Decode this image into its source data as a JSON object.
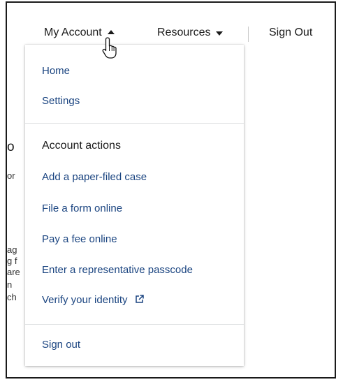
{
  "nav": {
    "my_account_label": "My Account",
    "resources_label": "Resources",
    "sign_out_label": "Sign Out"
  },
  "background_fragments": [
    "o",
    "or",
    "ag",
    "g f",
    "are",
    "n",
    "ch"
  ],
  "dropdown": {
    "top_items": [
      {
        "label": "Home"
      },
      {
        "label": "Settings"
      }
    ],
    "section_heading": "Account actions",
    "action_items": [
      {
        "label": "Add a paper-filed case"
      },
      {
        "label": "File a form online"
      },
      {
        "label": "Pay a fee online"
      },
      {
        "label": "Enter a representative passcode"
      },
      {
        "label": "Verify your identity",
        "icon": "external-link-icon"
      }
    ],
    "bottom_item": "Sign out"
  },
  "colors": {
    "link": "#1a4480",
    "text": "#1b1b1b",
    "separator": "#dfe1e2"
  },
  "icons": {
    "my_account_caret": "caret-up-icon",
    "resources_caret": "caret-down-icon",
    "cursor": "hand-pointer-cursor-icon"
  }
}
